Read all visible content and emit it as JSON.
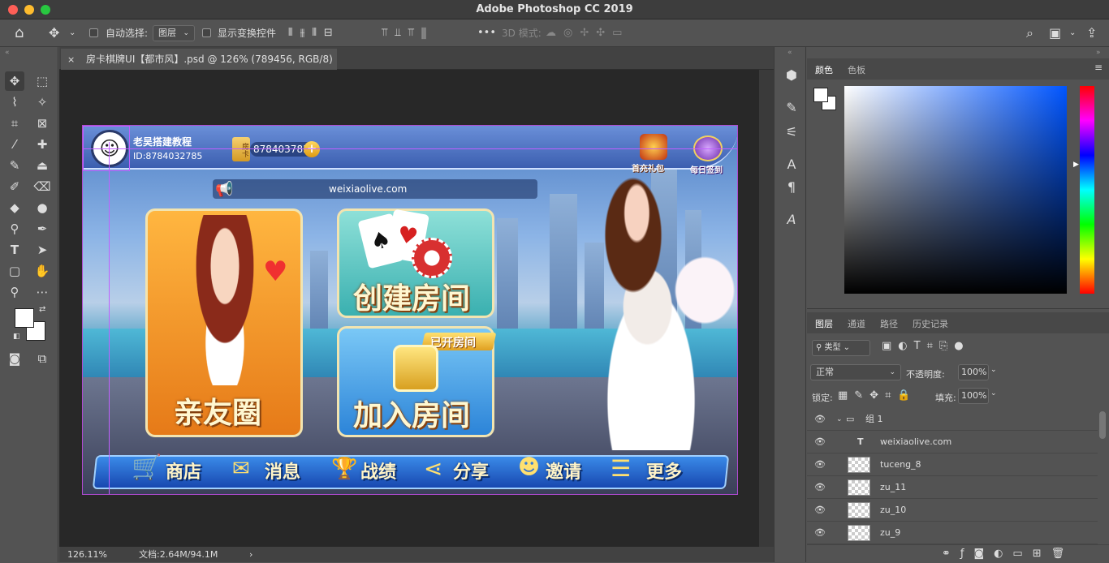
{
  "window": {
    "title": "Adobe Photoshop CC 2019"
  },
  "options_bar": {
    "auto_select_label": "自动选择:",
    "auto_select_value": "图层",
    "show_transform_label": "显示变换控件",
    "more": "•••",
    "mode_3d_label": "3D 模式:"
  },
  "document": {
    "tab_title": "房卡棋牌UI【都市风】.psd @ 126% (789456, RGB/8) *",
    "zoom": "126.11%",
    "doc_info": "文档:2.64M/94.1M"
  },
  "artwork": {
    "user_name": "老吴搭建教程",
    "user_id": "ID:8784032785",
    "room_card_label": "房卡",
    "cards_count": "878403785",
    "gift_label": "首充礼包",
    "checkin_label": "每日签到",
    "url_banner": "weixiaolive.com",
    "friends_circle": "亲友圈",
    "create_room": "创建房间",
    "join_room": "加入房间",
    "open_room_badge": "已开房间",
    "nav": [
      "商店",
      "消息",
      "战绩",
      "分享",
      "邀请",
      "更多"
    ]
  },
  "color_panel": {
    "tabs": [
      "颜色",
      "色板"
    ]
  },
  "layers_panel": {
    "tabs": [
      "图层",
      "通道",
      "路径",
      "历史记录"
    ],
    "blend_mode": "正常",
    "opacity_label": "不透明度:",
    "opacity_value": "100%",
    "lock_label": "锁定:",
    "fill_label": "填充:",
    "fill_value": "100%",
    "layers": [
      {
        "name": "组 1",
        "kind": "group"
      },
      {
        "name": "weixiaolive.com",
        "kind": "text"
      },
      {
        "name": "tuceng_8",
        "kind": "pixel"
      },
      {
        "name": "zu_11",
        "kind": "pixel"
      },
      {
        "name": "zu_10",
        "kind": "pixel"
      },
      {
        "name": "zu_9",
        "kind": "pixel"
      }
    ]
  },
  "colors": {
    "accent_purple": "#b04ad0",
    "ui_bg": "#535353",
    "canvas_bg": "#282828"
  }
}
